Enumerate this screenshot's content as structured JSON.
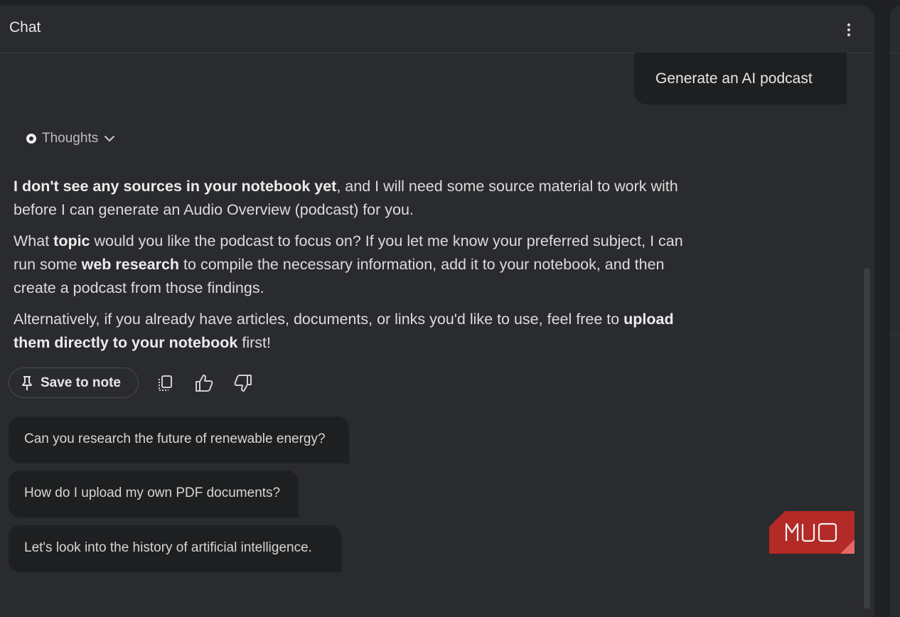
{
  "header": {
    "title": "Chat",
    "menu_icon": "more-vert-icon"
  },
  "user_message": "Generate an AI podcast",
  "thoughts": {
    "label": "Thoughts",
    "icon": "chevron-down-icon"
  },
  "response": {
    "p1": {
      "bold": "I don't see any sources in your notebook yet",
      "rest": ", and I will need some source material to work with before I can generate an Audio Overview (podcast) for you."
    },
    "p2": {
      "a": "What ",
      "b": "topic",
      "c": " would you like the podcast to focus on? If you let me know your preferred subject, I can run some ",
      "d": "web research",
      "e": " to compile the necessary information, add it to your notebook, and then create a podcast from those findings."
    },
    "p3": {
      "a": "Alternatively, if you already have articles, documents, or links you'd like to use, feel free to ",
      "b": "upload them directly to your notebook",
      "c": " first!"
    }
  },
  "actions": {
    "save_to_note": "Save to note",
    "icons": [
      "pin-icon",
      "copy-icon",
      "thumbs-up-icon",
      "thumbs-down-icon"
    ]
  },
  "suggestions": [
    "Can you research the future of renewable energy?",
    "How do I upload my own PDF documents?",
    "Let's look into the history of artificial intelligence."
  ],
  "watermark": "MUO",
  "colors": {
    "background": "#1f2022",
    "panel": "#2a2b2e",
    "bubble": "#1e1f21",
    "watermark": "#b32a26"
  }
}
